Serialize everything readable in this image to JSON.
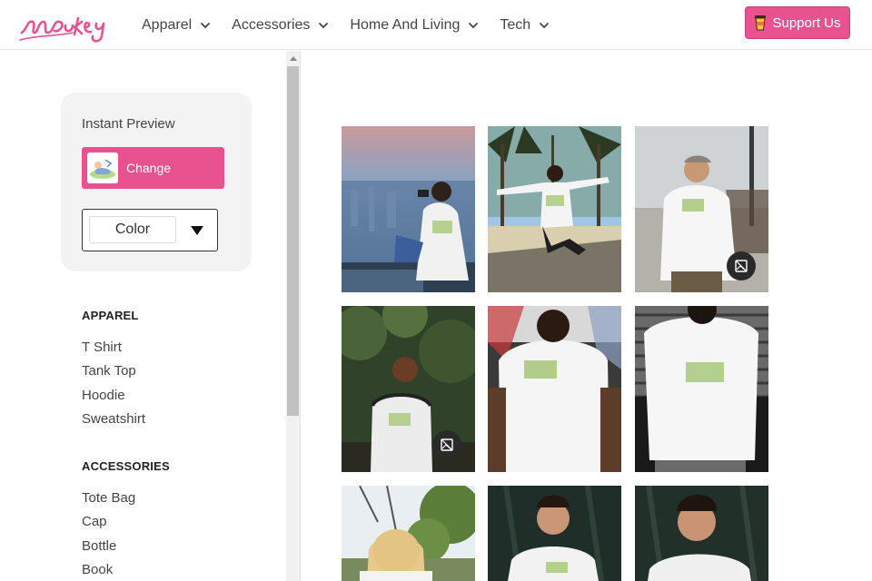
{
  "header": {
    "logo_text": "mockey",
    "nav": [
      {
        "label": "Apparel",
        "icon": "chevron-down-icon"
      },
      {
        "label": "Accessories",
        "icon": "chevron-down-icon"
      },
      {
        "label": "Home And Living",
        "icon": "chevron-down-icon"
      },
      {
        "label": "Tech",
        "icon": "chevron-down-icon"
      }
    ],
    "support_label": "Support Us",
    "support_icon": "coffee-cup-icon"
  },
  "sidebar": {
    "preview_title": "Instant Preview",
    "change_label": "Change",
    "color_value": "Color",
    "categories": [
      {
        "heading": "APPAREL",
        "items": [
          "T Shirt",
          "Tank Top",
          "Hoodie",
          "Sweatshirt"
        ]
      },
      {
        "heading": "ACCESSORIES",
        "items": [
          "Tote Bag",
          "Cap",
          "Bottle",
          "Book"
        ]
      }
    ]
  },
  "grid": {
    "tiles": [
      {
        "subject": "man-on-rooftop-city",
        "badge": false
      },
      {
        "subject": "man-jumping-palm-trees",
        "badge": false
      },
      {
        "subject": "man-in-cap-boardwalk",
        "badge": true
      },
      {
        "subject": "man-in-forest",
        "badge": true
      },
      {
        "subject": "man-back-crowd",
        "badge": false
      },
      {
        "subject": "man-back-shutter",
        "badge": false
      },
      {
        "subject": "woman-in-park",
        "badge": false
      },
      {
        "subject": "man-front-dark",
        "badge": false
      },
      {
        "subject": "man-front-dark-closeup",
        "badge": false
      }
    ]
  },
  "colors": {
    "brand_pink": "#e8538f",
    "text_dark": "#222222",
    "text": "#444444",
    "card_bg": "#f3f3f3"
  }
}
